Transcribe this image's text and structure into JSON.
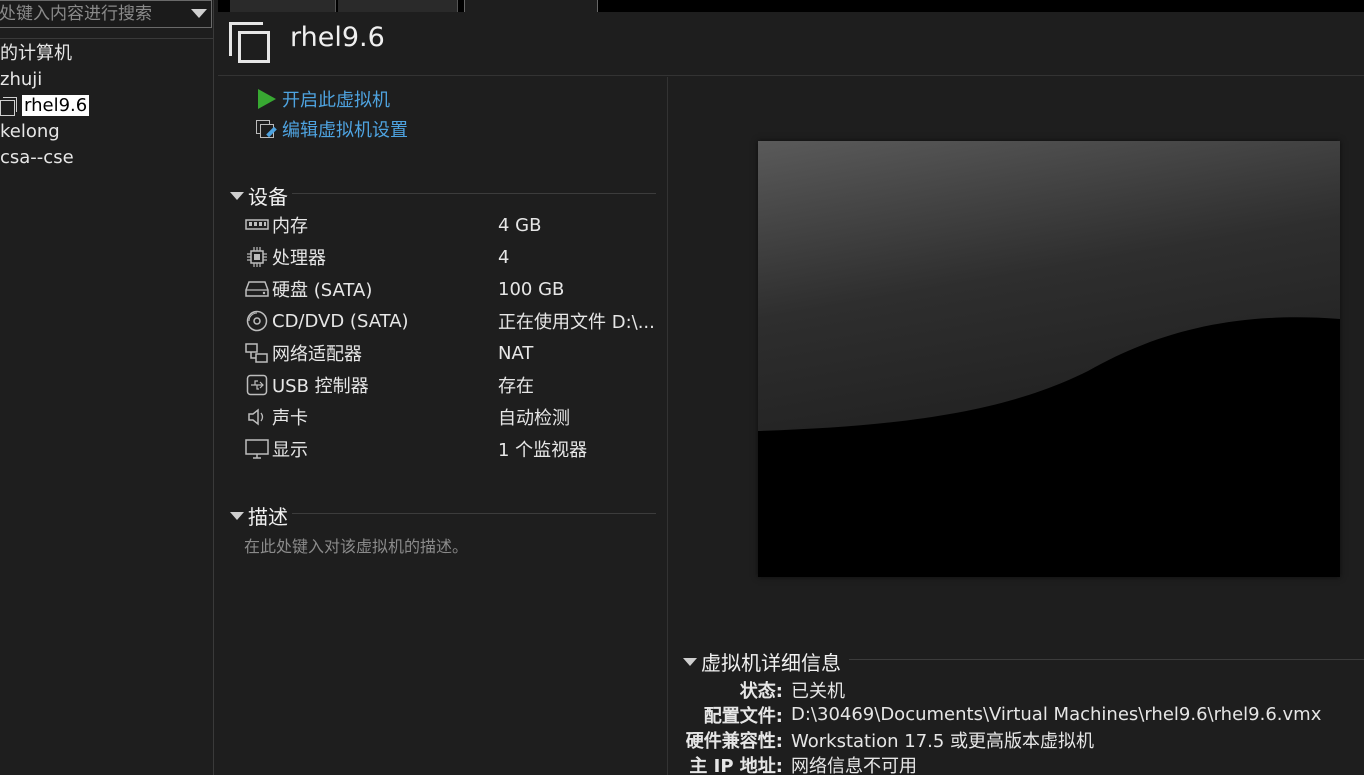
{
  "library": {
    "search_placeholder": "处键入内容进行搜索",
    "items": [
      {
        "label": "的计算机"
      },
      {
        "label": "zhuji"
      },
      {
        "label": "rhel9.6"
      },
      {
        "label": "kelong"
      },
      {
        "label": "csa--cse"
      }
    ]
  },
  "vm": {
    "title": "rhel9.6",
    "actions": {
      "start": "开启此虚拟机",
      "edit": "编辑虚拟机设置"
    }
  },
  "devices": {
    "heading": "设备",
    "rows": [
      {
        "name": "内存",
        "value": "4 GB",
        "icon": "memory-icon"
      },
      {
        "name": "处理器",
        "value": "4",
        "icon": "cpu-icon"
      },
      {
        "name": "硬盘 (SATA)",
        "value": "100 GB",
        "icon": "hard-disk-icon"
      },
      {
        "name": "CD/DVD (SATA)",
        "value": "正在使用文件 D:\\...",
        "icon": "cd-dvd-icon"
      },
      {
        "name": "网络适配器",
        "value": "NAT",
        "icon": "network-adapter-icon"
      },
      {
        "name": "USB 控制器",
        "value": "存在",
        "icon": "usb-icon"
      },
      {
        "name": "声卡",
        "value": "自动检测",
        "icon": "speaker-icon"
      },
      {
        "name": "显示",
        "value": "1 个监视器",
        "icon": "monitor-icon"
      }
    ]
  },
  "description": {
    "heading": "描述",
    "placeholder": "在此处键入对该虚拟机的描述。"
  },
  "details": {
    "heading": "虚拟机详细信息",
    "rows": [
      {
        "key": "状态:",
        "value": "已关机"
      },
      {
        "key": "配置文件:",
        "value": "D:\\30469\\Documents\\Virtual Machines\\rhel9.6\\rhel9.6.vmx"
      },
      {
        "key": "硬件兼容性:",
        "value": "Workstation 17.5 或更高版本虚拟机"
      },
      {
        "key": "主 IP 地址:",
        "value": "网络信息不可用"
      }
    ]
  },
  "colors": {
    "link": "#4ea3e0",
    "play": "#38a832",
    "background": "#1e1e1e"
  }
}
